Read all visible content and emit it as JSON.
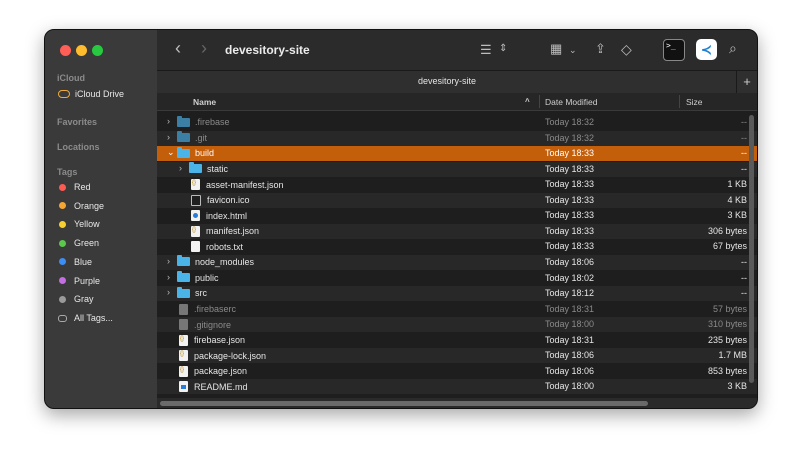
{
  "sidebar": {
    "icloud_title": "iCloud",
    "icloud_drive": "iCloud Drive",
    "favorites_title": "Favorites",
    "locations_title": "Locations",
    "tags_title": "Tags",
    "tags": [
      {
        "label": "Red",
        "color": "#ff5a52"
      },
      {
        "label": "Orange",
        "color": "#f7a731"
      },
      {
        "label": "Yellow",
        "color": "#f6d032"
      },
      {
        "label": "Green",
        "color": "#5ac84b"
      },
      {
        "label": "Blue",
        "color": "#3a8ef6"
      },
      {
        "label": "Purple",
        "color": "#c26fe0"
      },
      {
        "label": "Gray",
        "color": "#9a9a9a"
      }
    ],
    "all_tags": "All Tags..."
  },
  "toolbar": {
    "title": "devesitory-site",
    "back_icon": "‹",
    "forward_icon": "›",
    "list_icon": "☰",
    "grid_icon": "▦",
    "share_icon": "⇪",
    "tag_icon": "◇",
    "terminal_label": ">_",
    "vscode_label": "≺",
    "search_icon": "⌕"
  },
  "tab": {
    "title": "devesitory-site",
    "plus": "+"
  },
  "columns": {
    "name": "Name",
    "date": "Date Modified",
    "size": "Size",
    "sort_icon": "^"
  },
  "files": [
    {
      "name": ".firebase",
      "date": "Today 18:32",
      "size": "--",
      "kind": "folder",
      "indent": 0,
      "expander": ">",
      "dim": true
    },
    {
      "name": ".git",
      "date": "Today 18:32",
      "size": "--",
      "kind": "folder",
      "indent": 0,
      "expander": ">",
      "dim": true
    },
    {
      "name": "build",
      "date": "Today 18:33",
      "size": "--",
      "kind": "folder",
      "indent": 0,
      "expander": "v",
      "selected": true
    },
    {
      "name": "static",
      "date": "Today 18:33",
      "size": "--",
      "kind": "folder",
      "indent": 1,
      "expander": ">"
    },
    {
      "name": "asset-manifest.json",
      "date": "Today 18:33",
      "size": "1 KB",
      "kind": "json",
      "indent": 1
    },
    {
      "name": "favicon.ico",
      "date": "Today 18:33",
      "size": "4 KB",
      "kind": "ico",
      "indent": 1
    },
    {
      "name": "index.html",
      "date": "Today 18:33",
      "size": "3 KB",
      "kind": "html",
      "indent": 1
    },
    {
      "name": "manifest.json",
      "date": "Today 18:33",
      "size": "306 bytes",
      "kind": "json",
      "indent": 1
    },
    {
      "name": "robots.txt",
      "date": "Today 18:33",
      "size": "67 bytes",
      "kind": "txt",
      "indent": 1
    },
    {
      "name": "node_modules",
      "date": "Today 18:06",
      "size": "--",
      "kind": "folder",
      "indent": 0,
      "expander": ">"
    },
    {
      "name": "public",
      "date": "Today 18:02",
      "size": "--",
      "kind": "folder",
      "indent": 0,
      "expander": ">"
    },
    {
      "name": "src",
      "date": "Today 18:12",
      "size": "--",
      "kind": "folder",
      "indent": 0,
      "expander": ">"
    },
    {
      "name": ".firebaserc",
      "date": "Today 18:31",
      "size": "57 bytes",
      "kind": "gray",
      "indent": 0,
      "dim": true
    },
    {
      "name": ".gitignore",
      "date": "Today 18:00",
      "size": "310 bytes",
      "kind": "gray",
      "indent": 0,
      "dim": true
    },
    {
      "name": "firebase.json",
      "date": "Today 18:31",
      "size": "235 bytes",
      "kind": "json",
      "indent": 0
    },
    {
      "name": "package-lock.json",
      "date": "Today 18:06",
      "size": "1.7 MB",
      "kind": "json",
      "indent": 0
    },
    {
      "name": "package.json",
      "date": "Today 18:06",
      "size": "853 bytes",
      "kind": "json",
      "indent": 0
    },
    {
      "name": "README.md",
      "date": "Today 18:00",
      "size": "3 KB",
      "kind": "md",
      "indent": 0
    }
  ]
}
